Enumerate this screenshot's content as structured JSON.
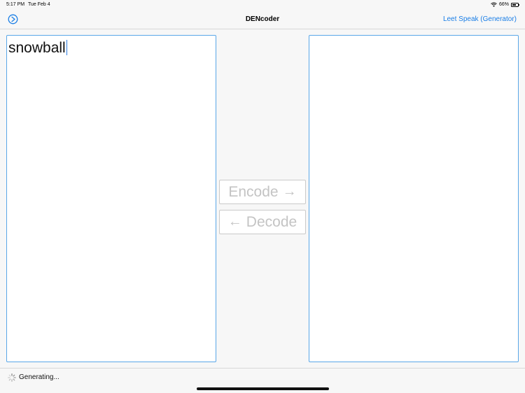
{
  "status_bar": {
    "time": "5:17 PM",
    "date": "Tue Feb 4",
    "battery": "66%",
    "battery_level": 0.66,
    "icons": [
      "wifi-icon",
      "battery-icon"
    ]
  },
  "nav": {
    "title": "DENcoder",
    "left_icon": "play-circle-icon",
    "right_button": "Leet Speak (Generator)",
    "accent_color": "#1a7ee6"
  },
  "input_panel": {
    "text": "snowball"
  },
  "output_panel": {
    "text": ""
  },
  "actions": {
    "encode_label": "Encode",
    "encode_arrow": "→",
    "decode_label": "Decode",
    "decode_arrow": "←"
  },
  "footer": {
    "status_text": "Generating...",
    "icon": "spinner-icon"
  }
}
